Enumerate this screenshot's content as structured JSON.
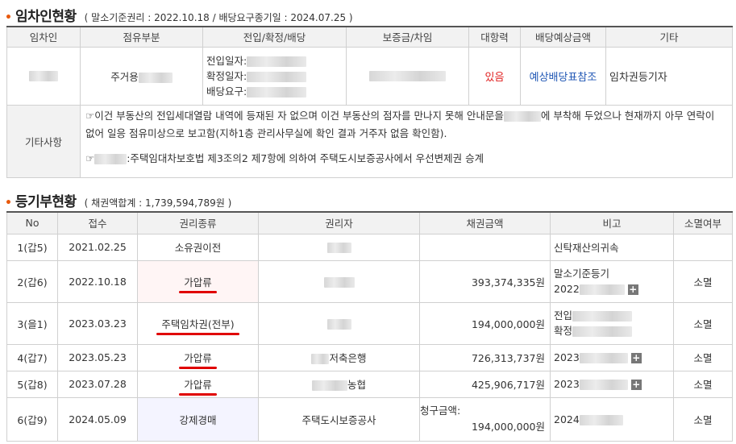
{
  "tenant_section": {
    "title": "임차인현황",
    "subtitle": "( 말소기준권리 : 2022.10.18 / 배당요구종기일 : 2024.07.25 )",
    "headers": [
      "임차인",
      "점유부분",
      "전입/확정/배당",
      "보증금/차임",
      "대항력",
      "배당예상금액",
      "기타"
    ],
    "row": {
      "occupancy": "주거용",
      "move_in_label": "전입일자:",
      "fixed_label": "확정일자:",
      "dividend_label": "배당요구:",
      "opposability": "있음",
      "expected_dividend": "예상배당표참조",
      "other": "임차권등기자"
    },
    "notes_label": "기타사항",
    "note1": "☞이건 부동산의 전입세대열람 내역에 등재된 자 없으며 이건 부동산의 점자를 만나지 못해 안내문을",
    "note1_cont": "에 부착해 두었으나 현재까지 아무 연락이 없어 일응 점유미상으로 보고함(지하1층 관리사무실에 확인 결과 거주자 없음 확인함).",
    "note2_prefix": "☞",
    "note2": ":주택임대차보호법 제3조의2 제7항에 의하여 주택도시보증공사에서 우선변제권 승계"
  },
  "registry_section": {
    "title": "등기부현황",
    "subtitle": "( 채권액합계 : 1,739,594,789원 )",
    "headers": [
      "No",
      "접수",
      "권리종류",
      "권리자",
      "채권금액",
      "비고",
      "소멸여부"
    ],
    "rows": [
      {
        "no": "1(갑5)",
        "date": "2021.02.25",
        "right": "소유권이전",
        "holder": "",
        "amount": "",
        "note": "신탁재산의귀속",
        "status": ""
      },
      {
        "no": "2(갑6)",
        "date": "2022.10.18",
        "right": "가압류",
        "holder": "",
        "amount": "393,374,335원",
        "note": "말소기준등기",
        "note2": "2022",
        "status": "소멸"
      },
      {
        "no": "3(을1)",
        "date": "2023.03.23",
        "right": "주택임차권(전부)",
        "holder": "",
        "amount": "194,000,000원",
        "note": "전입",
        "note2": "확정",
        "status": "소멸"
      },
      {
        "no": "4(갑7)",
        "date": "2023.05.23",
        "right": "가압류",
        "holder": "저축은행",
        "amount": "726,313,737원",
        "note": "2023",
        "status": "소멸"
      },
      {
        "no": "5(갑8)",
        "date": "2023.07.28",
        "right": "가압류",
        "holder": "농협",
        "amount": "425,906,717원",
        "note": "2023",
        "status": "소멸"
      },
      {
        "no": "6(갑9)",
        "date": "2024.05.09",
        "right": "강제경매",
        "holder": "주택도시보증공사",
        "amount_label": "청구금액:",
        "amount": "194,000,000원",
        "note": "2024",
        "status": "소멸"
      }
    ]
  },
  "colors": {
    "accent": "#e8590c",
    "red": "#e02020",
    "blue": "#1f56b4"
  }
}
